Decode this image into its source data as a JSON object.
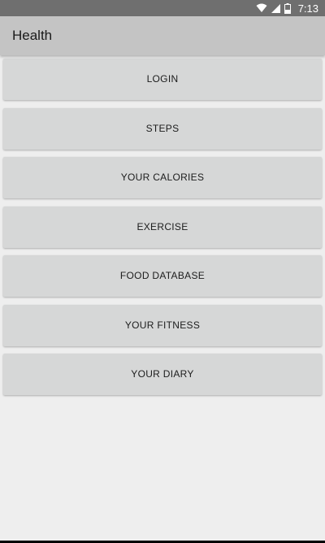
{
  "status_bar": {
    "time": "7:13",
    "icons": [
      "wifi-icon",
      "cell-signal-icon",
      "battery-icon"
    ]
  },
  "app_bar": {
    "title": "Health"
  },
  "menu": {
    "items": [
      {
        "label": "LOGIN"
      },
      {
        "label": "STEPS"
      },
      {
        "label": "YOUR CALORIES"
      },
      {
        "label": "EXERCISE"
      },
      {
        "label": "FOOD DATABASE"
      },
      {
        "label": "YOUR FITNESS"
      },
      {
        "label": "YOUR DIARY"
      }
    ]
  },
  "colors": {
    "status_bar": "#6f6f6f",
    "app_bar": "#c4c4c4",
    "background": "#eeeeee",
    "button": "#d6d7d7"
  }
}
